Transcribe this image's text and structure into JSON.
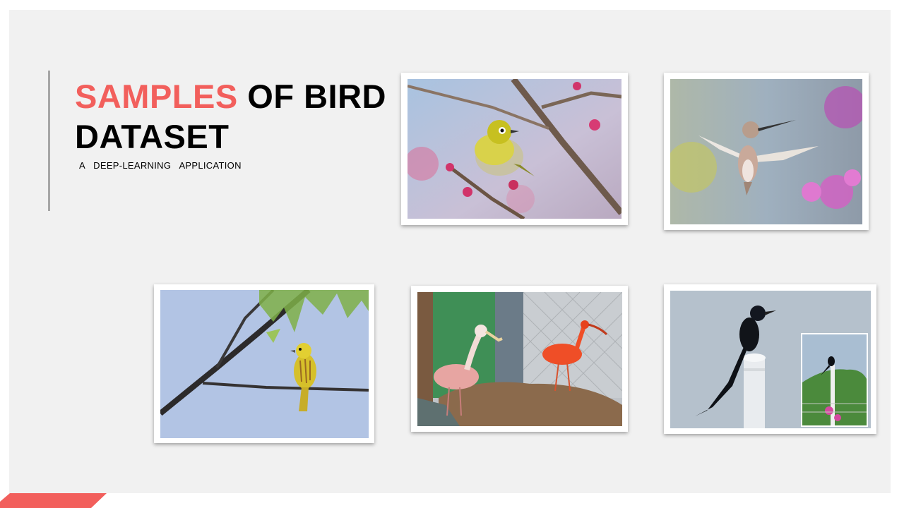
{
  "slide": {
    "title_highlight": "SAMPLES",
    "title_rest": " OF BIRD DATASET",
    "subtitle": "A DEEP-LEARNING APPLICATION",
    "accent_color": "#f25f5c"
  },
  "photos": [
    {
      "subject": "white-eye bird on cherry blossom branch"
    },
    {
      "subject": "hummingbird hovering near pink flowers"
    },
    {
      "subject": "yellow warbler perched on branch"
    },
    {
      "subject": "roseate spoonbill and scarlet ibis"
    },
    {
      "subject": "black drongo perched on white pole"
    }
  ]
}
